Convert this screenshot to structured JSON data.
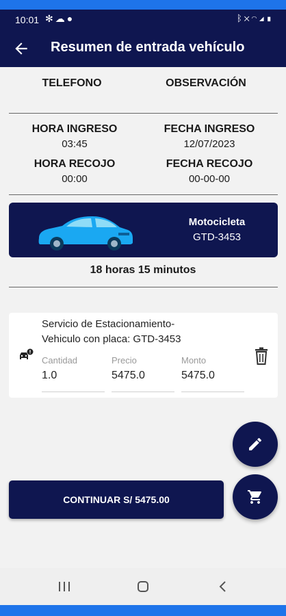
{
  "status_bar": {
    "time": "10:01",
    "left_icons": [
      "fan-icon",
      "cloud-icon",
      "circle-icon"
    ],
    "right_icons": [
      "bluetooth-icon",
      "mute-icon",
      "wifi-icon",
      "signal-icon",
      "battery-icon"
    ]
  },
  "app_bar": {
    "title": "Resumen de entrada vehículo"
  },
  "contact": {
    "telefono_label": "TELEFONO",
    "observacion_label": "OBSERVACIÓN"
  },
  "times": {
    "hora_ingreso_label": "HORA INGRESO",
    "hora_ingreso_value": "03:45",
    "fecha_ingreso_label": "FECHA INGRESO",
    "fecha_ingreso_value": "12/07/2023",
    "hora_recojo_label": "HORA RECOJO",
    "hora_recojo_value": "00:00",
    "fecha_recojo_label": "FECHA RECOJO",
    "fecha_recojo_value": "00-00-00"
  },
  "vehicle": {
    "type": "Motocicleta",
    "plate": "GTD-3453",
    "color": "#1aa8f2"
  },
  "duration": "18 horas 15 minutos",
  "service": {
    "title_line1": "Servicio de Estacionamiento-",
    "title_line2": "Vehiculo con placa: GTD-3453",
    "cantidad_label": "Cantidad",
    "cantidad_value": "1.0",
    "precio_label": "Precio",
    "precio_value": "5475.0",
    "monto_label": "Monto",
    "monto_value": "5475.0"
  },
  "actions": {
    "continue_label": "CONTINUAR S/ 5475.00",
    "edit_icon": "pencil-icon",
    "cart_icon": "cart-icon"
  },
  "colors": {
    "primary": "#0f1650",
    "accent": "#1e74ea"
  }
}
